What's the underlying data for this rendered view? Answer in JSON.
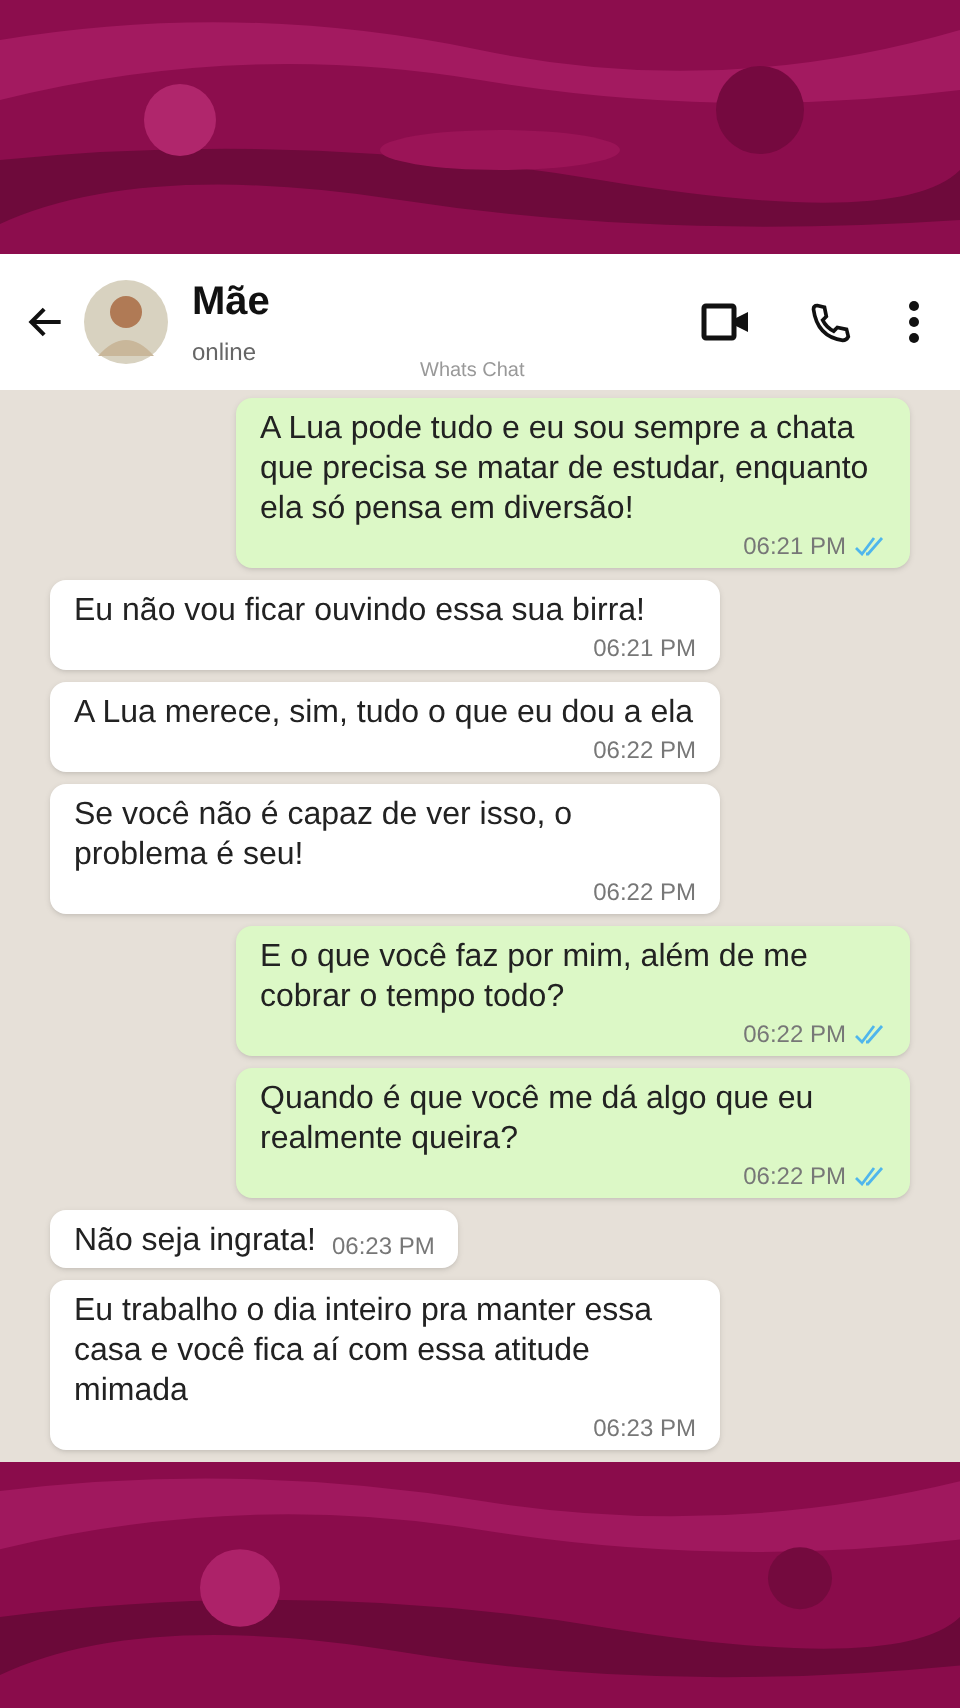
{
  "contact": {
    "name": "Mãe",
    "status": "online"
  },
  "watermark_label": "Whats Chat",
  "messages": [
    {
      "kind": "sent",
      "text": "A Lua pode tudo e eu sou sempre a chata que precisa se matar de estudar, enquanto ela só pensa em diversão!",
      "time": "06:21 PM",
      "read": true
    },
    {
      "kind": "received",
      "text": "Eu não vou ficar ouvindo essa sua birra!",
      "time": "06:21 PM"
    },
    {
      "kind": "received",
      "text": "A Lua merece, sim, tudo o que eu dou a ela",
      "time": "06:22 PM"
    },
    {
      "kind": "received",
      "text": "Se você não é capaz de ver isso, o problema é seu!",
      "time": "06:22 PM"
    },
    {
      "kind": "sent",
      "text": "E o que você faz por mim, além de me cobrar o tempo todo?",
      "time": "06:22 PM",
      "read": true
    },
    {
      "kind": "sent",
      "text": "Quando é que você me dá algo que eu realmente queira?",
      "time": "06:22 PM",
      "read": true
    },
    {
      "kind": "received",
      "text": "Não seja ingrata!",
      "time": "06:23 PM"
    },
    {
      "kind": "received",
      "text": "Eu trabalho o dia inteiro pra manter essa casa e você fica aí com essa atitude mimada",
      "time": "06:23 PM"
    }
  ]
}
